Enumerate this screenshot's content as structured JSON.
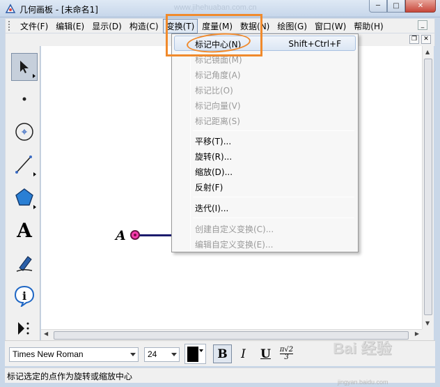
{
  "window": {
    "title": "几何画板 - [未命名1]",
    "url_watermark": "www.jihehuaban.com.cn",
    "minimize_label": "─",
    "maximize_label": "□",
    "close_label": "✕"
  },
  "menubar": {
    "items": [
      {
        "label": "文件(F)"
      },
      {
        "label": "编辑(E)"
      },
      {
        "label": "显示(D)"
      },
      {
        "label": "构造(C)"
      },
      {
        "label": "变换(T)"
      },
      {
        "label": "度量(M)"
      },
      {
        "label": "数据(N)"
      },
      {
        "label": "绘图(G)"
      },
      {
        "label": "窗口(W)"
      },
      {
        "label": "帮助(H)"
      }
    ],
    "active_index": 4
  },
  "transform_menu": {
    "items": [
      {
        "label": "标记中心(N)",
        "shortcut": "Shift+Ctrl+F",
        "enabled": true,
        "highlighted": true
      },
      {
        "label": "标记镜面(M)",
        "enabled": false
      },
      {
        "label": "标记角度(A)",
        "enabled": false
      },
      {
        "label": "标记比(O)",
        "enabled": false
      },
      {
        "label": "标记向量(V)",
        "enabled": false
      },
      {
        "label": "标记距离(S)",
        "enabled": false
      },
      {
        "label": "平移(T)...",
        "enabled": true
      },
      {
        "label": "旋转(R)...",
        "enabled": true
      },
      {
        "label": "缩放(D)...",
        "enabled": true
      },
      {
        "label": "反射(F)",
        "enabled": true
      },
      {
        "label": "迭代(I)...",
        "enabled": true
      },
      {
        "label": "创建自定义变换(C)...",
        "enabled": false
      },
      {
        "label": "编辑自定义变换(E)...",
        "enabled": false
      }
    ]
  },
  "toolbox": {
    "tools": [
      {
        "name": "select-arrow-tool",
        "selected": true
      },
      {
        "name": "point-tool"
      },
      {
        "name": "compass-tool"
      },
      {
        "name": "straightedge-tool"
      },
      {
        "name": "polygon-tool"
      },
      {
        "name": "text-tool",
        "glyph": "A"
      },
      {
        "name": "marker-tool"
      },
      {
        "name": "information-tool",
        "glyph": "i"
      },
      {
        "name": "custom-tool"
      }
    ]
  },
  "canvas": {
    "point_label": "A"
  },
  "format_bar": {
    "font": "Times New Roman",
    "size": "24",
    "bold": "B",
    "italic": "I",
    "underline": "U",
    "math_top": "π√2",
    "math_bottom": "3"
  },
  "status_bar": {
    "text": "标记选定的点作为旋转或缩放中心"
  },
  "watermark": {
    "text": "Bai 经验",
    "sub": "jingyan.baidu.com"
  },
  "colors": {
    "annotation": "#f08a2c",
    "point_fill": "#ff3bb0",
    "segment": "#1b1b6d"
  }
}
